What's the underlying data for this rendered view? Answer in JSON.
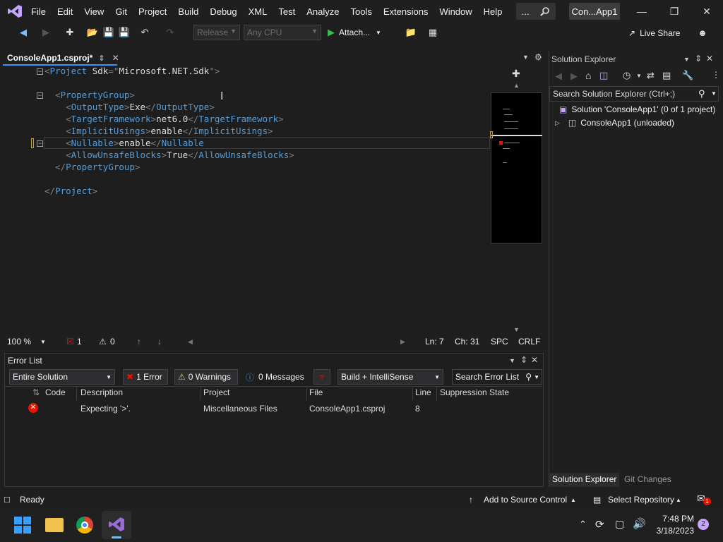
{
  "menubar": {
    "items": [
      "File",
      "Edit",
      "View",
      "Git",
      "Project",
      "Build",
      "Debug",
      "XML",
      "Test",
      "Analyze",
      "Tools",
      "Extensions",
      "Window",
      "Help"
    ],
    "overflow": "...",
    "title": "Con...App1"
  },
  "toolbar": {
    "config": "Release",
    "platform": "Any CPU",
    "attach": "Attach...",
    "live_share": "Live Share"
  },
  "editor": {
    "tab_title": "ConsoleApp1.csproj*",
    "lines": [
      {
        "parts": [
          [
            "br",
            "<"
          ],
          [
            "tag",
            "Project "
          ],
          [
            "txt",
            "Sdk"
          ],
          [
            "br",
            "=\""
          ],
          [
            "txt",
            "Microsoft.NET.Sdk"
          ],
          [
            "br",
            "\">"
          ]
        ]
      },
      {
        "parts": []
      },
      {
        "parts": [
          [
            "br",
            "  <"
          ],
          [
            "tag",
            "PropertyGroup"
          ],
          [
            "br",
            ">"
          ]
        ]
      },
      {
        "parts": [
          [
            "br",
            "    <"
          ],
          [
            "tag",
            "OutputType"
          ],
          [
            "br",
            ">"
          ],
          [
            "txt",
            "Exe"
          ],
          [
            "br",
            "</"
          ],
          [
            "tag",
            "OutputType"
          ],
          [
            "br",
            ">"
          ]
        ]
      },
      {
        "parts": [
          [
            "br",
            "    <"
          ],
          [
            "tag",
            "TargetFramework"
          ],
          [
            "br",
            ">"
          ],
          [
            "txt",
            "net6.0"
          ],
          [
            "br",
            "</"
          ],
          [
            "tag",
            "TargetFramework"
          ],
          [
            "br",
            ">"
          ]
        ]
      },
      {
        "parts": [
          [
            "br",
            "    <"
          ],
          [
            "tag",
            "ImplicitUsings"
          ],
          [
            "br",
            ">"
          ],
          [
            "txt",
            "enable"
          ],
          [
            "br",
            "</"
          ],
          [
            "tag",
            "ImplicitUsings"
          ],
          [
            "br",
            ">"
          ]
        ]
      },
      {
        "parts": [
          [
            "br",
            "    <"
          ],
          [
            "tag",
            "Nullable"
          ],
          [
            "br",
            ">"
          ],
          [
            "txt",
            "enable"
          ],
          [
            "br",
            "</"
          ],
          [
            "tag",
            "Nullable"
          ]
        ]
      },
      {
        "parts": [
          [
            "br",
            "    <"
          ],
          [
            "tag",
            "AllowUnsafeBlocks"
          ],
          [
            "br",
            ">"
          ],
          [
            "txt",
            "True"
          ],
          [
            "br",
            "</"
          ],
          [
            "tag",
            "AllowUnsafeBlocks"
          ],
          [
            "br",
            ">"
          ]
        ]
      },
      {
        "parts": [
          [
            "br",
            "  </"
          ],
          [
            "tag",
            "PropertyGroup"
          ],
          [
            "br",
            ">"
          ]
        ]
      },
      {
        "parts": []
      },
      {
        "parts": [
          [
            "br",
            "</"
          ],
          [
            "tag",
            "Project"
          ],
          [
            "br",
            ">"
          ]
        ]
      }
    ]
  },
  "editor_status": {
    "zoom": "100 %",
    "errors": "1",
    "warnings": "0",
    "line": "Ln: 7",
    "col": "Ch: 31",
    "spc": "SPC",
    "eol": "CRLF"
  },
  "error_list": {
    "title": "Error List",
    "scope": "Entire Solution",
    "errors_btn": "1 Error",
    "warnings_btn": "0 Warnings",
    "messages_btn": "0 Messages",
    "build_filter": "Build + IntelliSense",
    "search_placeholder": "Search Error List",
    "columns": [
      "Code",
      "Description",
      "Project",
      "File",
      "Line",
      "Suppression State"
    ],
    "rows": [
      {
        "code": "",
        "description": "Expecting '>'.",
        "project": "Miscellaneous Files",
        "file": "ConsoleApp1.csproj",
        "line": "8",
        "suppression": ""
      }
    ]
  },
  "solution_explorer": {
    "title": "Solution Explorer",
    "search_placeholder": "Search Solution Explorer (Ctrl+;)",
    "solution": "Solution 'ConsoleApp1' (0 of 1 project)",
    "project": "ConsoleApp1 (unloaded)",
    "tabs": [
      "Solution Explorer",
      "Git Changes"
    ]
  },
  "statusbar": {
    "ready": "Ready",
    "source_control": "Add to Source Control",
    "repository": "Select Repository",
    "notifications": "1"
  },
  "taskbar": {
    "time": "7:48 PM",
    "date": "3/18/2023",
    "badge": "2"
  },
  "colors": {
    "accent": "#3794ff",
    "error": "#e51400",
    "vs_purple": "#9b6bd7"
  }
}
